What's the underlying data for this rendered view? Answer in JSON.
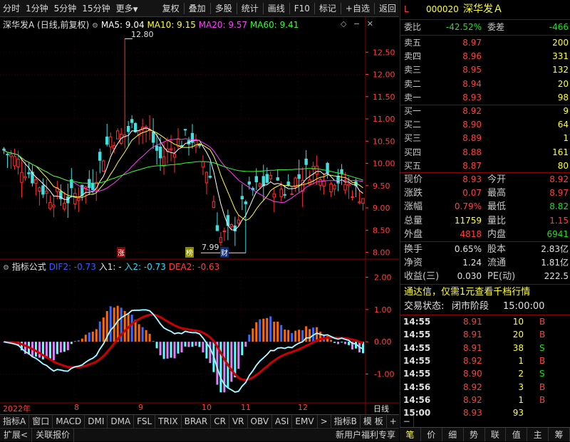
{
  "toolbar": {
    "left_items": [
      "分时",
      "1分钟",
      "5分钟",
      "15分钟",
      "更多"
    ],
    "right_items": [
      "复权",
      "叠加",
      "多股",
      "统计",
      "画线",
      "F10",
      "标记",
      "+自选",
      "返回"
    ]
  },
  "chart_header": {
    "title": "深华发A (日线,前复权)",
    "ma5": "MA5: 9.04",
    "ma10": "MA10: 9.15",
    "ma20": "MA20: 9.57",
    "ma60": "MA60: 9.41"
  },
  "chart_annotations": {
    "high": "12.80",
    "low": "7.99",
    "marker_zhang": "涨",
    "marker_bang": "榜",
    "marker_cai": "财"
  },
  "indicator_header": {
    "name": "指标公式",
    "dif": "DIF2: -0.73",
    "ru1": "入1: -",
    "ru2": "入2: -0.73",
    "dea": "DEA2: -0.63"
  },
  "x_axis": {
    "year": "2022年",
    "months": [
      "8",
      "9",
      "10",
      "11",
      "12"
    ],
    "period": "日线"
  },
  "chart_data": [
    {
      "type": "candlestick",
      "title": "深华发A (日线,前复权)",
      "y_ticks": [
        12.5,
        12.0,
        11.5,
        11.0,
        10.5,
        10.0,
        9.5,
        9.0,
        8.5,
        8.0
      ],
      "ylim": [
        7.85,
        13.0
      ],
      "annotations": {
        "high": 12.8,
        "low": 7.99
      },
      "series": [
        {
          "name": "MA5",
          "last": 9.04,
          "color": "#ffffff"
        },
        {
          "name": "MA10",
          "last": 9.15,
          "color": "#ffff33"
        },
        {
          "name": "MA20",
          "last": 9.57,
          "color": "#ff40ff"
        },
        {
          "name": "MA60",
          "last": 9.41,
          "color": "#33ff33"
        }
      ]
    },
    {
      "type": "line",
      "title": "指标公式",
      "y_ticks": [
        2.0,
        1.0,
        0.0,
        -1.0
      ],
      "ylim": [
        -1.85,
        2.3
      ],
      "series": [
        {
          "name": "DIF2",
          "last": -0.73
        },
        {
          "name": "入2",
          "last": -0.73
        },
        {
          "name": "DEA2",
          "last": -0.63
        }
      ]
    }
  ],
  "quote": {
    "code": "000020",
    "name": "深华发Ａ",
    "marker": "L",
    "weibi_label": "委比",
    "weibi": "-42.52%",
    "weicha_label": "委差",
    "weicha": "-466",
    "asks": [
      {
        "label": "卖五",
        "price": "8.97",
        "vol": "200"
      },
      {
        "label": "卖四",
        "price": "8.96",
        "vol": "331"
      },
      {
        "label": "卖三",
        "price": "8.95",
        "vol": "132"
      },
      {
        "label": "卖二",
        "price": "8.94",
        "vol": "20"
      },
      {
        "label": "卖一",
        "price": "8.93",
        "vol": "98"
      }
    ],
    "bids": [
      {
        "label": "买一",
        "price": "8.92",
        "vol": "9"
      },
      {
        "label": "买二",
        "price": "8.90",
        "vol": "64"
      },
      {
        "label": "买三",
        "price": "8.89",
        "vol": "1"
      },
      {
        "label": "买四",
        "price": "8.88",
        "vol": "161"
      },
      {
        "label": "买五",
        "price": "8.87",
        "vol": "80"
      }
    ],
    "stats": [
      {
        "l1": "现价",
        "v1": "8.93",
        "c1": "red",
        "l2": "今开",
        "v2": "8.92",
        "c2": "red"
      },
      {
        "l1": "涨跌",
        "v1": "0.07",
        "c1": "red",
        "l2": "最高",
        "v2": "8.97",
        "c2": "red"
      },
      {
        "l1": "涨幅",
        "v1": "0.79%",
        "c1": "red",
        "l2": "最低",
        "v2": "8.82",
        "c2": "green"
      },
      {
        "l1": "总量",
        "v1": "11759",
        "c1": "yel",
        "l2": "量比",
        "v2": "1.15",
        "c2": "red"
      },
      {
        "l1": "外盘",
        "v1": "4818",
        "c1": "red",
        "l2": "内盘",
        "v2": "6941",
        "c2": "green"
      }
    ],
    "fin": [
      {
        "l1": "换手",
        "v1": "0.65%",
        "l2": "股本",
        "v2": "2.83亿"
      },
      {
        "l1": "净资",
        "v1": "1.24",
        "l2": "流通",
        "v2": "1.81亿"
      },
      {
        "l1": "收益(三)",
        "v1": "0.030",
        "l2": "PE(动)",
        "v2": "222.5"
      }
    ],
    "promo": "通达信，仅需1元查看千档行情",
    "trade_status_label": "交易状态:",
    "trade_status": "闭市阶段",
    "trade_time": "15:00:00"
  },
  "ticks": [
    {
      "time": "14:55",
      "price": "8.91",
      "vol": "10",
      "side": "B"
    },
    {
      "time": "14:55",
      "price": "8.91",
      "vol": "20",
      "side": "B"
    },
    {
      "time": "14:55",
      "price": "8.91",
      "vol": "38",
      "side": "S"
    },
    {
      "time": "14:55",
      "price": "8.92",
      "vol": "1",
      "side": "B"
    },
    {
      "time": "14:55",
      "price": "8.90",
      "vol": "2",
      "side": "S"
    },
    {
      "time": "14:56",
      "price": "8.92",
      "vol": "3",
      "side": "B"
    },
    {
      "time": "14:56",
      "price": "8.92",
      "vol": "1",
      "side": "B"
    },
    {
      "time": "15:00",
      "price": "8.93",
      "vol": "93",
      "side": ""
    }
  ],
  "indicator_tabs": [
    "指标A",
    "窗口",
    "MACD",
    "DMI",
    "DMA",
    "FSL",
    "TRIX",
    "BRAR",
    "CR",
    "VR",
    "OBV",
    "ASI",
    "EMV",
    ">",
    "指标B",
    "模 板",
    "+",
    "−"
  ],
  "status_left": [
    "扩展<",
    "关联报价"
  ],
  "status_right": "新用户福利专享",
  "right_tabs": [
    "笔",
    "价",
    "细",
    "势",
    "联",
    "值",
    "主",
    "筹"
  ]
}
